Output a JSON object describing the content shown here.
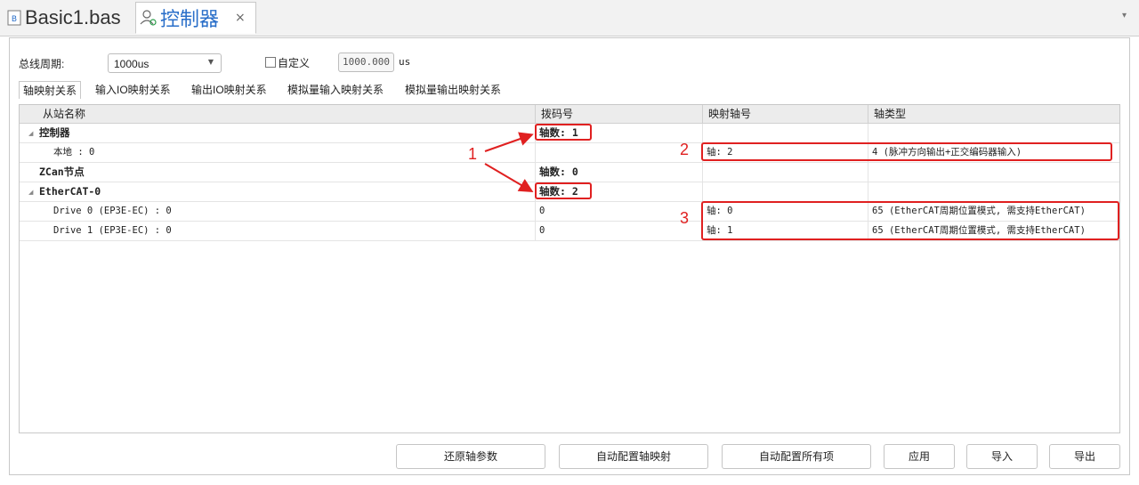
{
  "tabs": [
    {
      "label": "Basic1.bas",
      "icon": "file-icon"
    },
    {
      "label": "控制器",
      "icon": "user-icon",
      "close": "×"
    }
  ],
  "tab_menu_arrow": "▾",
  "bus": {
    "label": "总线周期:",
    "value": "1000us",
    "custom_label": "自定义",
    "custom_value": "1000.000",
    "unit": "us"
  },
  "subtabs": [
    "轴映射关系",
    "输入IO映射关系",
    "输出IO映射关系",
    "模拟量输入映射关系",
    "模拟量输出映射关系"
  ],
  "columns": [
    "从站名称",
    "拨码号",
    "映射轴号",
    "轴类型"
  ],
  "rows": [
    {
      "name": "控制器",
      "dip": "轴数: 1",
      "axis": "",
      "type": ""
    },
    {
      "name": "本地 : 0",
      "dip": "",
      "axis": "轴: 2",
      "type": "4 (脉冲方向输出+正交编码器输入)"
    },
    {
      "name": "ZCan节点",
      "dip": "轴数: 0",
      "axis": "",
      "type": ""
    },
    {
      "name": "EtherCAT-0",
      "dip": "轴数: 2",
      "axis": "",
      "type": ""
    },
    {
      "name": "Drive 0 (EP3E-EC) : 0",
      "dip": "0",
      "axis": "轴: 0",
      "type": "65 (EtherCAT周期位置模式, 需支持EtherCAT)"
    },
    {
      "name": "Drive 1 (EP3E-EC) : 0",
      "dip": "0",
      "axis": "轴: 1",
      "type": "65 (EtherCAT周期位置模式, 需支持EtherCAT)"
    }
  ],
  "annotations": {
    "one": "1",
    "two": "2",
    "three": "3"
  },
  "buttons": [
    "还原轴参数",
    "自动配置轴映射",
    "自动配置所有项",
    "应用",
    "导入",
    "导出"
  ]
}
